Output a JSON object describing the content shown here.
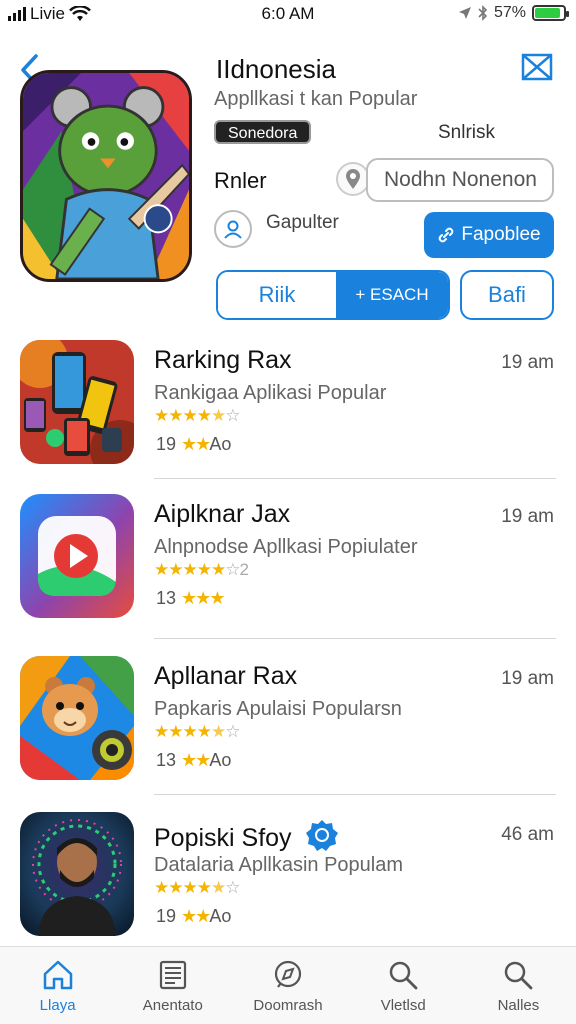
{
  "status_bar": {
    "carrier": "Livie",
    "time": "6:0 AM",
    "battery": "57%",
    "battery_level": 0.57
  },
  "header": {
    "title": "IIdnonesia",
    "subtitle": "Appllkasi t kan Popular",
    "badge": "Sonedora",
    "side_label": "Snlrisk",
    "rank_label": "Rnler",
    "search_placeholder": "Nodhn Nonenon",
    "profile_label": "Gapulter",
    "fav_button": "Fapoblee",
    "segment": {
      "left": "Riik",
      "right": "+ ESACH"
    },
    "right_button": "Bafi"
  },
  "list": [
    {
      "title": "Rarking Rax",
      "subtitle": "Rankigaa Aplikasi Popular",
      "stars": "4.5",
      "meta_count": "19",
      "meta_suffix": "Ao",
      "time": "19 am"
    },
    {
      "title": "Aiplknar Jax",
      "subtitle": "Alnpnodse Apllkasi Popiulater",
      "stars": "4.5",
      "stars_extra": "2",
      "meta_count": "13",
      "meta_suffix": "",
      "time": "19 am"
    },
    {
      "title": "Apllanar Rax",
      "subtitle": "Papkaris Apulaisi Popularsn",
      "stars": "4",
      "meta_count": "13",
      "meta_suffix": "Ao",
      "time": "19 am"
    },
    {
      "title": "Popiski Sfoy",
      "subtitle": "Datalaria Apllkasin Populam",
      "stars": "4",
      "meta_count": "19",
      "meta_suffix": "Ao",
      "time": "46 am"
    }
  ],
  "tabs": [
    {
      "label": "Llaya",
      "icon": "home-icon",
      "active": true
    },
    {
      "label": "Anentato",
      "icon": "news-icon",
      "active": false
    },
    {
      "label": "Doomrash",
      "icon": "compass-icon",
      "active": false
    },
    {
      "label": "Vletlsd",
      "icon": "search-icon",
      "active": false
    },
    {
      "label": "Nalles",
      "icon": "search-icon",
      "active": false
    }
  ],
  "colors": {
    "accent": "#1a82dc",
    "star": "#f4b400",
    "battery": "#2ecc40"
  }
}
